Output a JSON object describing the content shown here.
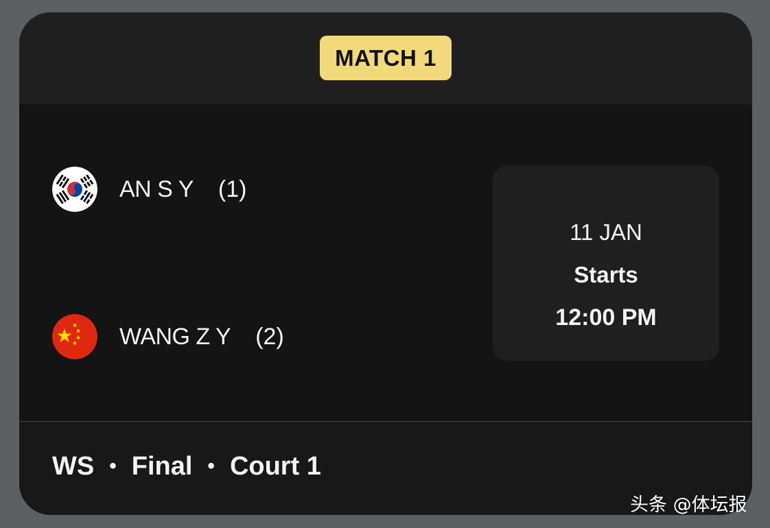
{
  "badge": {
    "label": "MATCH 1",
    "color": "#f1d97c"
  },
  "players": [
    {
      "name": "AN S Y",
      "seed": "(1)",
      "flag_icon": "south-korea-flag-icon"
    },
    {
      "name": "WANG Z Y",
      "seed": "(2)",
      "flag_icon": "china-flag-icon"
    }
  ],
  "schedule": {
    "date": "11 JAN",
    "status": "Starts",
    "time": "12:00 PM"
  },
  "footer": {
    "event": "WS",
    "round": "Final",
    "court": "Court 1",
    "separator": "•"
  },
  "watermark": "头条 @体坛报"
}
